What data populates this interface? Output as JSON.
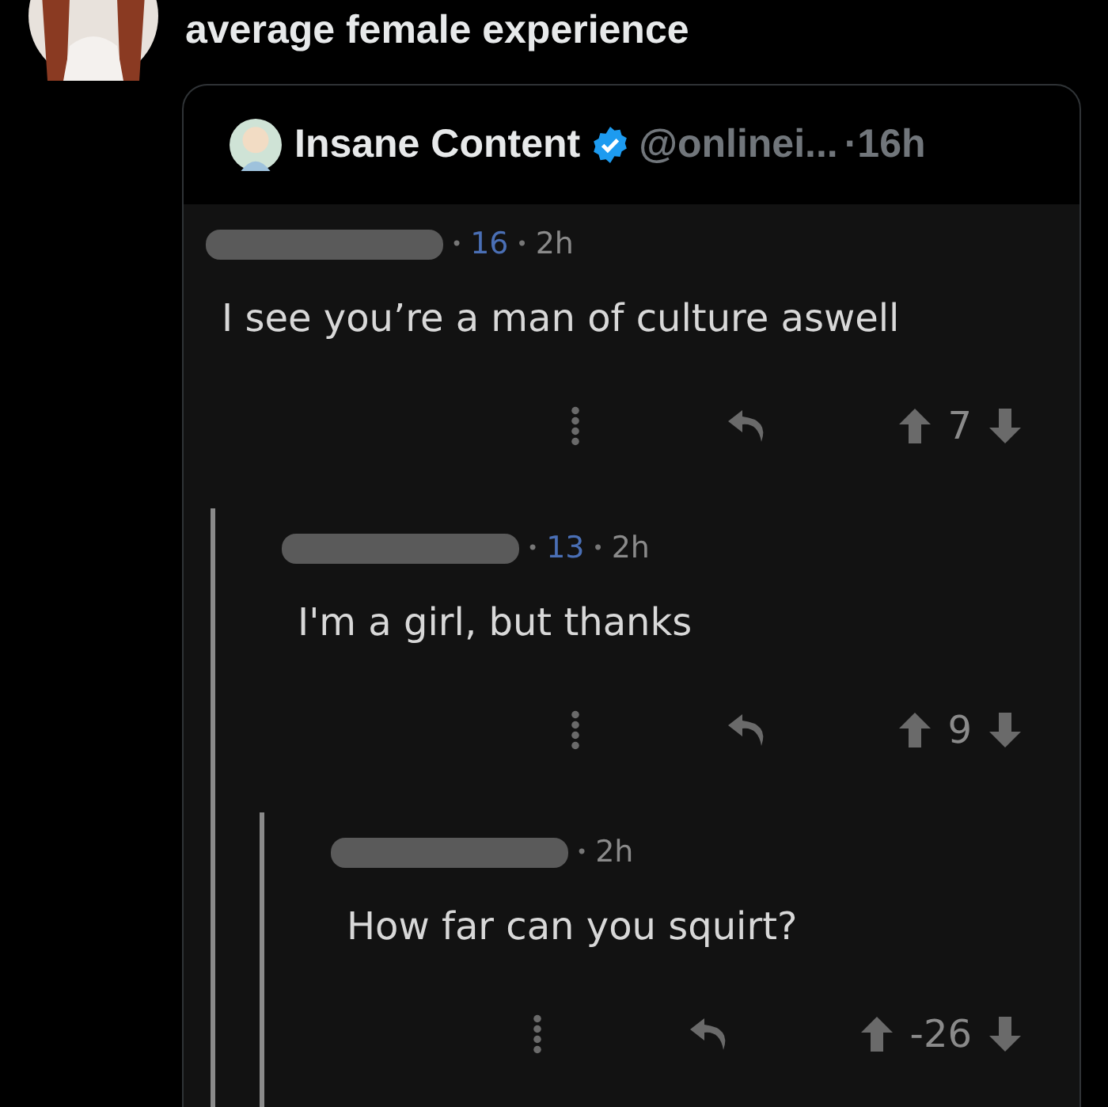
{
  "post": {
    "text": "average female experience"
  },
  "quote": {
    "author": {
      "name": "Insane Content",
      "verified": true,
      "handle": "@onlinei...",
      "time": "·16h"
    },
    "comments": [
      {
        "meta": [
          {
            "kind": "sep",
            "text": "•"
          },
          {
            "kind": "score",
            "text": "16"
          },
          {
            "kind": "sep",
            "text": "•"
          },
          {
            "kind": "time",
            "text": "2h"
          }
        ],
        "text": "I see you’re a man of culture aswell",
        "votes": "7",
        "children": [
          {
            "meta": [
              {
                "kind": "sep",
                "text": "•"
              },
              {
                "kind": "score",
                "text": "13"
              },
              {
                "kind": "sep",
                "text": "•"
              },
              {
                "kind": "time",
                "text": "2h"
              }
            ],
            "text": "I'm a girl, but thanks",
            "votes": "9",
            "children": [
              {
                "meta": [
                  {
                    "kind": "sep",
                    "text": "•"
                  },
                  {
                    "kind": "time",
                    "text": "2h"
                  }
                ],
                "text": "How far can you squirt?",
                "votes": "-26"
              }
            ]
          }
        ]
      }
    ]
  }
}
